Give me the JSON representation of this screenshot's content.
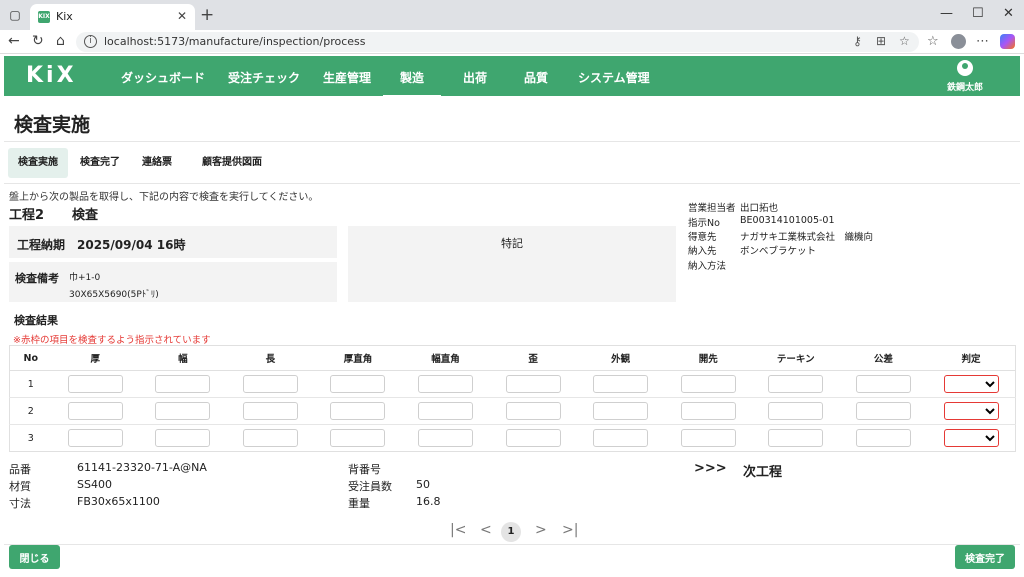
{
  "browser": {
    "tab_title": "Kix",
    "favicon_text": "KIX",
    "url": "localhost:5173/manufacture/inspection/process"
  },
  "app": {
    "logo": "KiX",
    "nav": [
      "ダッシュボード",
      "受注チェック",
      "生産管理",
      "製造",
      "出荷",
      "品質",
      "システム管理"
    ],
    "active_nav": "製造",
    "user_name": "鉄鋼太郎",
    "accent_color": "#3fa66f"
  },
  "page": {
    "title": "検査実施",
    "tabs": [
      "検査実施",
      "検査完了",
      "連絡票",
      "顧客提供図面"
    ],
    "active_tab": "検査実施",
    "instruction": "盤上から次の製品を取得し、下記の内容で検査を実行してください。",
    "process_no": "工程2",
    "process_name": "検査"
  },
  "deadline": {
    "label": "工程納期",
    "value": "2025/09/04 16時"
  },
  "memo": {
    "label": "検査備考",
    "line1": "巾+1-0",
    "line2": "30X65X5690(5Pﾄﾞﾘ)"
  },
  "special": {
    "label": "特記"
  },
  "order_info": [
    {
      "key": "営業担当者",
      "value": "出口拓也"
    },
    {
      "key": "指示No",
      "value": "BE00314101005-01"
    },
    {
      "key": "得意先",
      "value": "ナガサキ工業株式会社　織機向"
    },
    {
      "key": "納入先",
      "value": "ボンベブラケット"
    },
    {
      "key": "納入方法",
      "value": ""
    }
  ],
  "results": {
    "label": "検査結果",
    "warning": "※赤枠の項目を検査するよう指示されています",
    "columns": [
      "No",
      "厚",
      "幅",
      "長",
      "厚直角",
      "幅直角",
      "歪",
      "外観",
      "開先",
      "テーキン",
      "公差",
      "判定"
    ],
    "rows": [
      "1",
      "2",
      "3"
    ]
  },
  "spec": {
    "part_no": {
      "label": "品番",
      "value": "61141-23320-71-A@NA"
    },
    "material": {
      "label": "材質",
      "value": "SS400"
    },
    "size": {
      "label": "寸法",
      "value": "FB30x65x1100"
    },
    "back_no": {
      "label": "背番号",
      "value": ""
    },
    "order_qty": {
      "label": "受注員数",
      "value": "50"
    },
    "weight": {
      "label": "重量",
      "value": "16.8"
    }
  },
  "next_process": {
    "arrow": ">>>",
    "label": "次工程"
  },
  "pagination": {
    "first": "|<",
    "prev": "<",
    "current": "1",
    "next": ">",
    "last": ">|"
  },
  "footer": {
    "close_label": "閉じる",
    "complete_label": "検査完了"
  }
}
